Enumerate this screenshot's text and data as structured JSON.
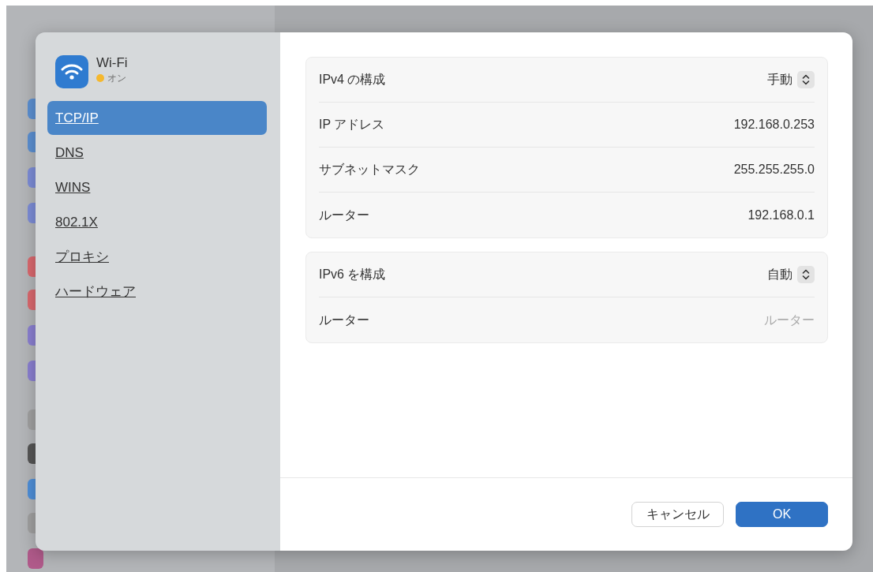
{
  "header": {
    "title": "Wi-Fi",
    "status": "オン",
    "color": "#f5b82e"
  },
  "sidebar": {
    "items": [
      {
        "label": "TCP/IP",
        "selected": true
      },
      {
        "label": "DNS",
        "selected": false
      },
      {
        "label": "WINS",
        "selected": false
      },
      {
        "label": "802.1X",
        "selected": false
      },
      {
        "label": "プロキシ",
        "selected": false
      },
      {
        "label": "ハードウェア",
        "selected": false
      }
    ]
  },
  "groups": [
    {
      "rows": [
        {
          "kind": "popup",
          "label": "IPv4 の構成",
          "value": "手動"
        },
        {
          "kind": "text",
          "label": "IP アドレス",
          "value": "192.168.0.253"
        },
        {
          "kind": "text",
          "label": "サブネットマスク",
          "value": "255.255.255.0"
        },
        {
          "kind": "text",
          "label": "ルーター",
          "value": "192.168.0.1"
        }
      ]
    },
    {
      "rows": [
        {
          "kind": "popup",
          "label": "IPv6 を構成",
          "value": "自動"
        },
        {
          "kind": "field",
          "label": "ルーター",
          "placeholder": "ルーター"
        }
      ]
    }
  ],
  "buttons": [
    {
      "label": "キャンセル",
      "kind": "secondary"
    },
    {
      "label": "OK",
      "kind": "default"
    }
  ]
}
